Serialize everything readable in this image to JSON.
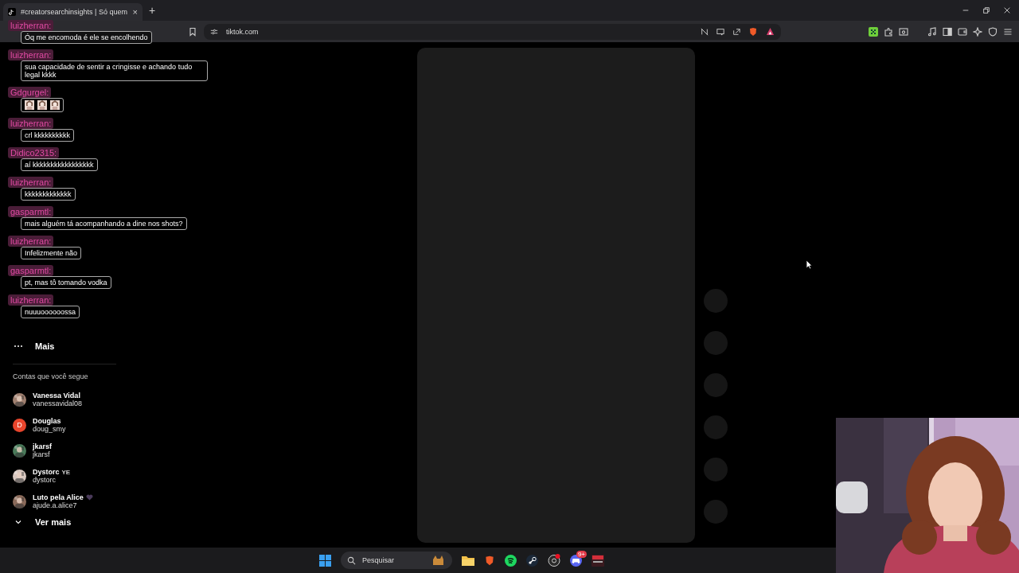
{
  "browser": {
    "tab_title": "#creatorsearchinsights | Só quem",
    "address": "tiktok.com",
    "tab_close": "×",
    "new_tab": "+"
  },
  "chat": [
    {
      "user": "luizherran:",
      "kind": "text",
      "message": "Óq me encomoda é ele se encolhendo"
    },
    {
      "user": "luizherran:",
      "kind": "text",
      "message": "sua capacidade de sentir a cringisse e achando tudo legal kkkk"
    },
    {
      "user": "Gdgurgel:",
      "kind": "emotes"
    },
    {
      "user": "luizherran:",
      "kind": "text",
      "message": "crl kkkkkkkkkk"
    },
    {
      "user": "Didico2315:",
      "kind": "text",
      "message": "aí kkkkkkkkkkkkkkkkk"
    },
    {
      "user": "luizherran:",
      "kind": "text",
      "message": "kkkkkkkkkkkkk"
    },
    {
      "user": "gasparmtl:",
      "kind": "text",
      "message": "mais alguém tá acompanhando a dine nos shots?"
    },
    {
      "user": "luizherran:",
      "kind": "text",
      "message": "Infelizmente não"
    },
    {
      "user": "gasparmtl:",
      "kind": "text",
      "message": "pt, mas tô tomando vodka"
    },
    {
      "user": "luizherran:",
      "kind": "text",
      "message": "nuuuoooooossa"
    }
  ],
  "sidebar": {
    "more_label": "Mais",
    "following_title": "Contas que você segue",
    "accounts": [
      {
        "name": "Vanessa Vidal",
        "handle": "vanessavidal08",
        "kind": "picture",
        "heart": false
      },
      {
        "name": "Douglas",
        "handle": "doug_smy",
        "kind": "letter",
        "letter": "D",
        "color": "#e8452c",
        "heart": false
      },
      {
        "name": "jkarsf",
        "handle": "jkarsf",
        "kind": "picture",
        "heart": false
      },
      {
        "name": "Dystorc",
        "suffix": "YE",
        "handle": "dystorc",
        "kind": "picture",
        "heart": false
      },
      {
        "name": "Luto pela Alice",
        "handle": "ajude.a.alice7",
        "kind": "picture",
        "heart": true
      }
    ],
    "see_more": "Ver mais"
  },
  "taskbar": {
    "search_placeholder": "Pesquisar",
    "discord_badge": "9+"
  }
}
